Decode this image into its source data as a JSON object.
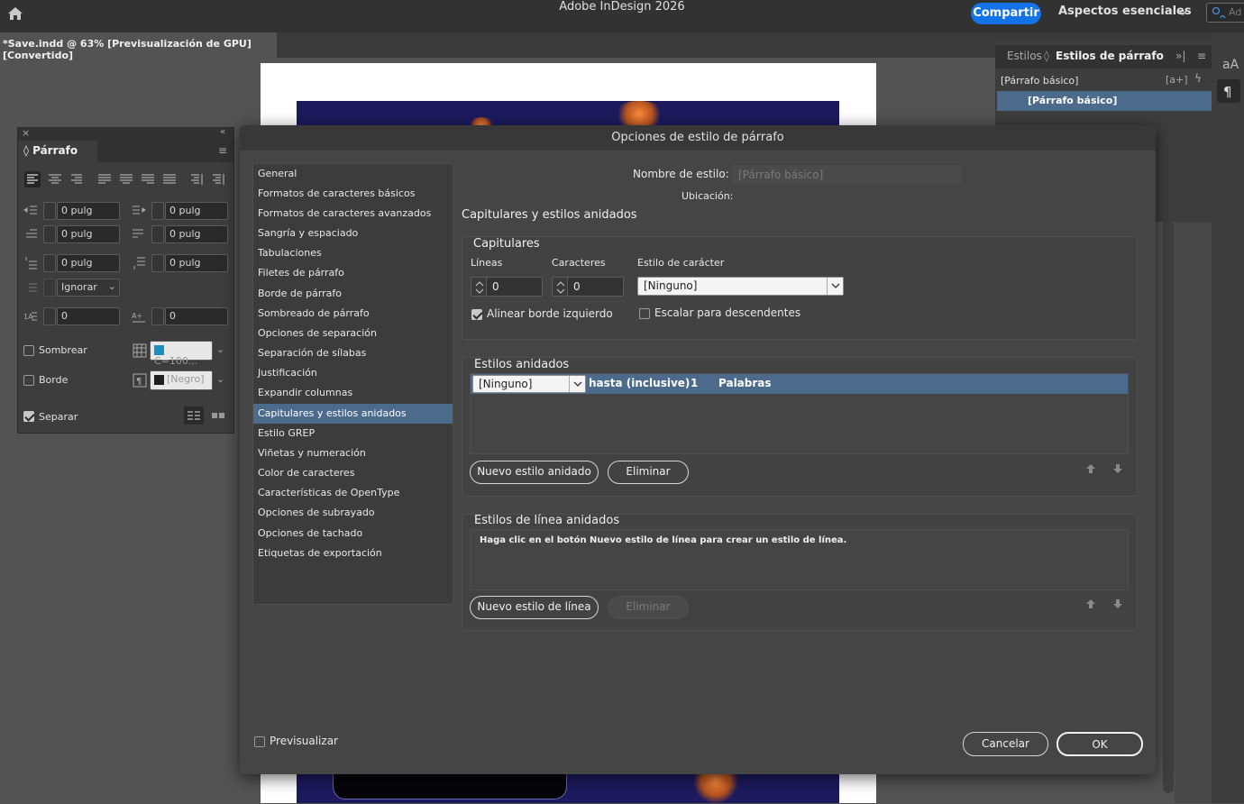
{
  "app": {
    "title": "Adobe InDesign 2026",
    "share_label": "Compartir",
    "workspace_label": "Aspectos esenciales",
    "search_placeholder": "Ad",
    "document_tab": "*Save.indd @ 63% [Previsualización de GPU] [Convertido]"
  },
  "styles_panel": {
    "tabs": [
      "Estilos",
      "Estilos de párrafo"
    ],
    "current_style": "[Párrafo básico]",
    "items": [
      "[Párrafo básico]"
    ]
  },
  "paragraph_panel": {
    "title": "Párrafo",
    "indent_left": "0 pulg",
    "indent_right": "0 pulg",
    "first_line_indent": "0 pulg",
    "last_line_indent": "0 pulg",
    "space_before": "0 pulg",
    "space_after": "0 pulg",
    "align_to_grid": "Ignorar",
    "dropcap_lines": "0",
    "dropcap_chars": "0",
    "shading_label": "Sombrear",
    "shading_swatch": "C=100...",
    "border_label": "Borde",
    "border_swatch": "[Negro]",
    "split_label": "Separar",
    "shading_color": "#1a8fc0",
    "border_color": "#1f1f1f"
  },
  "dialog": {
    "title": "Opciones de estilo de párrafo",
    "categories": [
      "General",
      "Formatos de caracteres básicos",
      "Formatos de caracteres avanzados",
      "Sangría y espaciado",
      "Tabulaciones",
      "Filetes de párrafo",
      "Borde de párrafo",
      "Sombreado de párrafo",
      "Opciones de separación",
      "Separación de sílabas",
      "Justificación",
      "Expandir columnas",
      "Capitulares y estilos anidados",
      "Estilo GREP",
      "Viñetas y numeración",
      "Color de caracteres",
      "Características de OpenType",
      "Opciones de subrayado",
      "Opciones de tachado",
      "Etiquetas de exportación"
    ],
    "selected_category": "Capitulares y estilos anidados",
    "style_name_label": "Nombre de estilo:",
    "style_name_value": "[Párrafo básico]",
    "location_label": "Ubicación:",
    "section_title": "Capitulares y estilos anidados",
    "dropcaps": {
      "group_title": "Capitulares",
      "lines_label": "Líneas",
      "lines_value": "0",
      "chars_label": "Caracteres",
      "chars_value": "0",
      "char_style_label": "Estilo de carácter",
      "char_style_value": "[Ninguno]",
      "align_left_label": "Alinear borde izquierdo",
      "align_left_checked": true,
      "scale_desc_label": "Escalar para descendentes",
      "scale_desc_checked": false
    },
    "nested": {
      "group_title": "Estilos anidados",
      "row_style": "[Ninguno]",
      "row_mode": "hasta (inclusive)",
      "row_count": "1",
      "row_unit": "Palabras",
      "new_button": "Nuevo estilo anidado",
      "delete_button": "Eliminar"
    },
    "line_styles": {
      "group_title": "Estilos de línea anidados",
      "hint": "Haga clic en el botón Nuevo estilo de línea para crear un estilo de línea.",
      "new_button": "Nuevo estilo de línea",
      "delete_button": "Eliminar"
    },
    "preview_label": "Previsualizar",
    "cancel_button": "Cancelar",
    "ok_button": "OK"
  }
}
